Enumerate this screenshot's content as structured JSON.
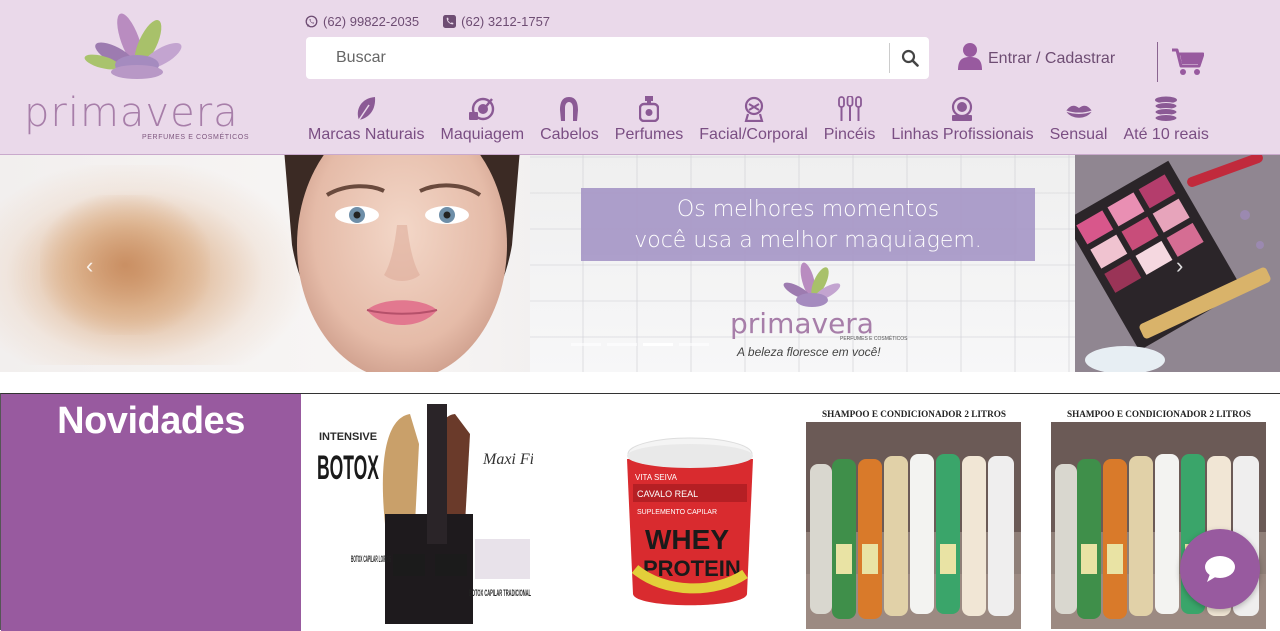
{
  "brand": {
    "name": "primavera",
    "tagline": "PERFUMES E COSMÉTICOS"
  },
  "contact": {
    "whatsapp": "(62) 99822-2035",
    "phone": "(62) 3212-1757"
  },
  "search": {
    "placeholder": "Buscar"
  },
  "account": {
    "login_label": "Entrar / Cadastrar"
  },
  "nav": {
    "items": [
      {
        "label": "Marcas Naturais",
        "icon": "leaf-icon"
      },
      {
        "label": "Maquiagem",
        "icon": "makeup-icon"
      },
      {
        "label": "Cabelos",
        "icon": "hair-icon"
      },
      {
        "label": "Perfumes",
        "icon": "perfume-icon"
      },
      {
        "label": "Facial/Corporal",
        "icon": "face-body-icon"
      },
      {
        "label": "Pincéis",
        "icon": "brushes-icon"
      },
      {
        "label": "Linhas Profissionais",
        "icon": "professional-icon"
      },
      {
        "label": "Sensual",
        "icon": "lips-icon"
      },
      {
        "label": "Até 10 reais",
        "icon": "coins-icon"
      }
    ]
  },
  "banner": {
    "headline_line1": "Os melhores momentos",
    "headline_line2": "você usa a melhor maquiagem.",
    "brand": "primavera",
    "brand_sub": "PERFUMES E COSMÉTICOS",
    "slogan": "A beleza floresce em você!",
    "slides_count": 4,
    "active_slide": 3
  },
  "novidades": {
    "title": "Novidades",
    "products": [
      {
        "image_text_1": "INTENSIVE",
        "image_text_2": "BOTOX",
        "image_text_3": "Maxi Fios",
        "image_text_4": "BOTOX CAPILAR LOIROS",
        "image_text_5": "BOTOX CAPILAR TRADICIONAL"
      },
      {
        "image_text_1": "VITA SEIVA",
        "image_text_2": "CAVALO REAL",
        "image_text_3": "SUPLEMENTO CAPILAR",
        "image_text_4": "WHEY",
        "image_text_5": "PROTEIN"
      },
      {
        "image_text_1": "SHAMPOO E CONDICIONADOR 2 LITROS"
      },
      {
        "image_text_1": "SHAMPOO E CONDICIONADOR 2 LITROS"
      }
    ]
  },
  "colors": {
    "header_bg": "#ead9ea",
    "accent": "#985a9f",
    "nav_text": "#7a4e83",
    "banner_box": "#a99ac8"
  }
}
